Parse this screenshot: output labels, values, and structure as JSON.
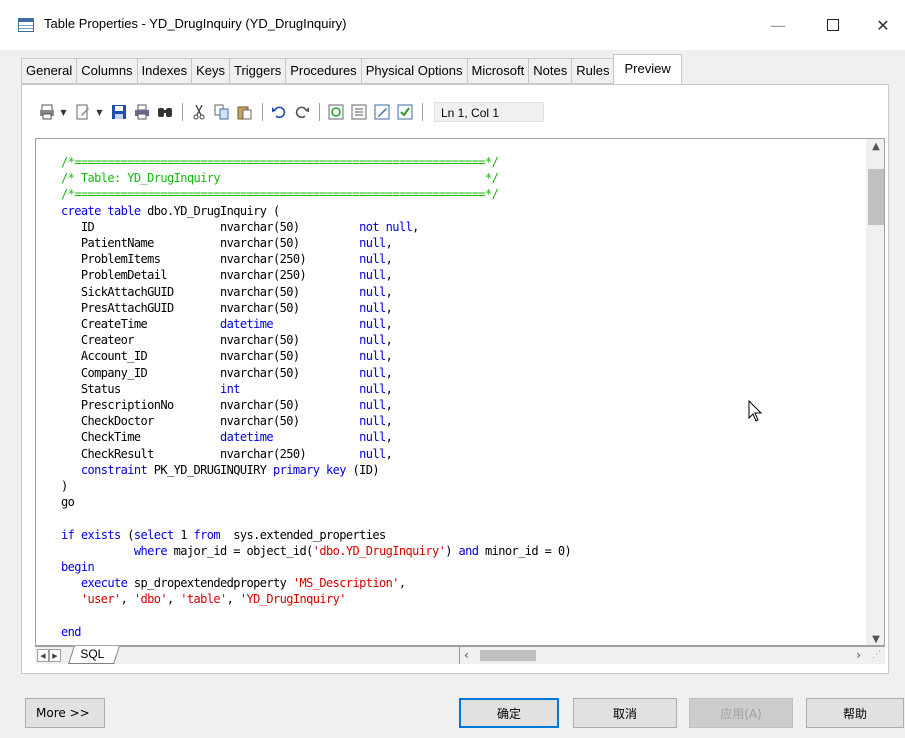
{
  "window": {
    "title": "Table Properties - YD_DrugInquiry (YD_DrugInquiry)",
    "minimize_glyph": "—",
    "close_glyph": "✕"
  },
  "tabs": [
    {
      "label": "General"
    },
    {
      "label": "Columns"
    },
    {
      "label": "Indexes"
    },
    {
      "label": "Keys"
    },
    {
      "label": "Triggers"
    },
    {
      "label": "Procedures"
    },
    {
      "label": "Physical Options"
    },
    {
      "label": "Microsoft"
    },
    {
      "label": "Notes"
    },
    {
      "label": "Rules"
    },
    {
      "label": "Preview",
      "active": true
    }
  ],
  "toolbar": {
    "icons": [
      "print-menu-icon",
      "edit-menu-icon",
      "save-icon",
      "print-icon",
      "find-icon",
      "cut-icon",
      "copy-icon",
      "paste-icon",
      "undo-icon",
      "redo-icon",
      "refresh-icon",
      "show-lines-icon",
      "edit-preview-icon",
      "check-icon"
    ],
    "cursor_position": "Ln 1, Col 1"
  },
  "editor": {
    "lines": [
      {
        "tokens": [
          {
            "t": "/*==============================================================*/",
            "c": "cm"
          }
        ]
      },
      {
        "tokens": [
          {
            "t": "/* Table: YD_DrugInquiry                                        */",
            "c": "cm"
          }
        ]
      },
      {
        "tokens": [
          {
            "t": "/*==============================================================*/",
            "c": "cm"
          }
        ]
      },
      {
        "tokens": [
          {
            "t": "create table",
            "c": "kw"
          },
          {
            "t": " dbo.YD_DrugInquiry (",
            "c": ""
          }
        ]
      },
      {
        "tokens": [
          {
            "t": "   ID                   nvarchar(50)         ",
            "c": ""
          },
          {
            "t": "not null",
            "c": "kw"
          },
          {
            "t": ",",
            "c": ""
          }
        ]
      },
      {
        "tokens": [
          {
            "t": "   PatientName          nvarchar(50)         ",
            "c": ""
          },
          {
            "t": "null",
            "c": "kw"
          },
          {
            "t": ",",
            "c": ""
          }
        ]
      },
      {
        "tokens": [
          {
            "t": "   ProblemItems         nvarchar(250)        ",
            "c": ""
          },
          {
            "t": "null",
            "c": "kw"
          },
          {
            "t": ",",
            "c": ""
          }
        ]
      },
      {
        "tokens": [
          {
            "t": "   ProblemDetail        nvarchar(250)        ",
            "c": ""
          },
          {
            "t": "null",
            "c": "kw"
          },
          {
            "t": ",",
            "c": ""
          }
        ]
      },
      {
        "tokens": [
          {
            "t": "   SickAttachGUID       nvarchar(50)         ",
            "c": ""
          },
          {
            "t": "null",
            "c": "kw"
          },
          {
            "t": ",",
            "c": ""
          }
        ]
      },
      {
        "tokens": [
          {
            "t": "   PresAttachGUID       nvarchar(50)         ",
            "c": ""
          },
          {
            "t": "null",
            "c": "kw"
          },
          {
            "t": ",",
            "c": ""
          }
        ]
      },
      {
        "tokens": [
          {
            "t": "   CreateTime           ",
            "c": ""
          },
          {
            "t": "datetime",
            "c": "kw"
          },
          {
            "t": "             ",
            "c": ""
          },
          {
            "t": "null",
            "c": "kw"
          },
          {
            "t": ",",
            "c": ""
          }
        ]
      },
      {
        "tokens": [
          {
            "t": "   Createor             nvarchar(50)         ",
            "c": ""
          },
          {
            "t": "null",
            "c": "kw"
          },
          {
            "t": ",",
            "c": ""
          }
        ]
      },
      {
        "tokens": [
          {
            "t": "   Account_ID           nvarchar(50)         ",
            "c": ""
          },
          {
            "t": "null",
            "c": "kw"
          },
          {
            "t": ",",
            "c": ""
          }
        ]
      },
      {
        "tokens": [
          {
            "t": "   Company_ID           nvarchar(50)         ",
            "c": ""
          },
          {
            "t": "null",
            "c": "kw"
          },
          {
            "t": ",",
            "c": ""
          }
        ]
      },
      {
        "tokens": [
          {
            "t": "   Status               ",
            "c": ""
          },
          {
            "t": "int",
            "c": "kw"
          },
          {
            "t": "                  ",
            "c": ""
          },
          {
            "t": "null",
            "c": "kw"
          },
          {
            "t": ",",
            "c": ""
          }
        ]
      },
      {
        "tokens": [
          {
            "t": "   PrescriptionNo       nvarchar(50)         ",
            "c": ""
          },
          {
            "t": "null",
            "c": "kw"
          },
          {
            "t": ",",
            "c": ""
          }
        ]
      },
      {
        "tokens": [
          {
            "t": "   CheckDoctor          nvarchar(50)         ",
            "c": ""
          },
          {
            "t": "null",
            "c": "kw"
          },
          {
            "t": ",",
            "c": ""
          }
        ]
      },
      {
        "tokens": [
          {
            "t": "   CheckTime            ",
            "c": ""
          },
          {
            "t": "datetime",
            "c": "kw"
          },
          {
            "t": "             ",
            "c": ""
          },
          {
            "t": "null",
            "c": "kw"
          },
          {
            "t": ",",
            "c": ""
          }
        ]
      },
      {
        "tokens": [
          {
            "t": "   CheckResult          nvarchar(250)        ",
            "c": ""
          },
          {
            "t": "null",
            "c": "kw"
          },
          {
            "t": ",",
            "c": ""
          }
        ]
      },
      {
        "tokens": [
          {
            "t": "   ",
            "c": ""
          },
          {
            "t": "constraint",
            "c": "kw"
          },
          {
            "t": " PK_YD_DRUGINQUIRY ",
            "c": ""
          },
          {
            "t": "primary key",
            "c": "kw"
          },
          {
            "t": " (ID)",
            "c": ""
          }
        ]
      },
      {
        "tokens": [
          {
            "t": ")",
            "c": ""
          }
        ]
      },
      {
        "tokens": [
          {
            "t": "go",
            "c": ""
          }
        ]
      },
      {
        "tokens": [
          {
            "t": "",
            "c": ""
          }
        ]
      },
      {
        "tokens": [
          {
            "t": "if exists",
            "c": "kw"
          },
          {
            "t": " (",
            "c": ""
          },
          {
            "t": "select",
            "c": "kw"
          },
          {
            "t": " 1 ",
            "c": ""
          },
          {
            "t": "from",
            "c": "kw"
          },
          {
            "t": "  sys.extended_properties",
            "c": ""
          }
        ]
      },
      {
        "tokens": [
          {
            "t": "           ",
            "c": ""
          },
          {
            "t": "where",
            "c": "kw"
          },
          {
            "t": " major_id = object_id(",
            "c": ""
          },
          {
            "t": "'dbo.YD_DrugInquiry'",
            "c": "st"
          },
          {
            "t": ") ",
            "c": ""
          },
          {
            "t": "and",
            "c": "kw"
          },
          {
            "t": " minor_id = 0)",
            "c": ""
          }
        ]
      },
      {
        "tokens": [
          {
            "t": "begin",
            "c": "kw"
          }
        ]
      },
      {
        "tokens": [
          {
            "t": "   ",
            "c": ""
          },
          {
            "t": "execute",
            "c": "kw"
          },
          {
            "t": " sp_dropextendedproperty ",
            "c": ""
          },
          {
            "t": "'MS_Description'",
            "c": "st"
          },
          {
            "t": ",",
            "c": ""
          }
        ]
      },
      {
        "tokens": [
          {
            "t": "   ",
            "c": ""
          },
          {
            "t": "'user'",
            "c": "st"
          },
          {
            "t": ", ",
            "c": ""
          },
          {
            "t": "'dbo'",
            "c": "st"
          },
          {
            "t": ", ",
            "c": ""
          },
          {
            "t": "'table'",
            "c": "st"
          },
          {
            "t": ", ",
            "c": ""
          },
          {
            "t": "'YD_DrugInquiry'",
            "c": "st"
          }
        ]
      },
      {
        "tokens": [
          {
            "t": "",
            "c": ""
          }
        ]
      },
      {
        "tokens": [
          {
            "t": "end",
            "c": "kw"
          }
        ]
      }
    ],
    "sheet_tab": "SQL"
  },
  "footer": {
    "more": "More >>",
    "ok": "确定",
    "cancel": "取消",
    "apply": "应用(A)",
    "help": "帮助"
  },
  "colors": {
    "comment": "#16b80e",
    "keyword": "#0000dd",
    "string": "#d40000"
  }
}
